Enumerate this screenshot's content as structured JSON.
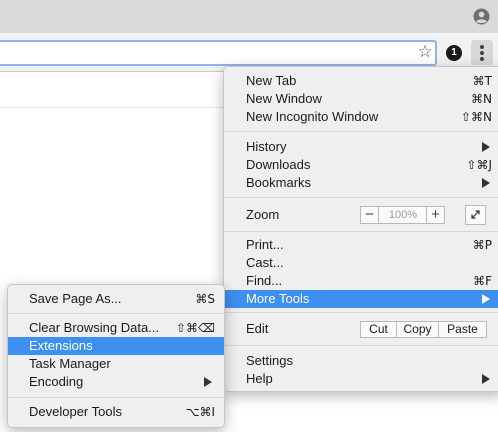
{
  "browser": {
    "profile_icon": "profile-avatar-icon",
    "star_icon": "bookmark-star-icon",
    "extension_badge": "1",
    "menu_icon": "three-dot-menu-icon"
  },
  "main_menu": {
    "new_tab": {
      "label": "New Tab",
      "shortcut": "⌘T"
    },
    "new_window": {
      "label": "New Window",
      "shortcut": "⌘N"
    },
    "new_incognito": {
      "label": "New Incognito Window",
      "shortcut": "⇧⌘N"
    },
    "history": {
      "label": "History"
    },
    "downloads": {
      "label": "Downloads",
      "shortcut": "⇧⌘J"
    },
    "bookmarks": {
      "label": "Bookmarks"
    },
    "zoom": {
      "label": "Zoom",
      "minus": "−",
      "level": "100%",
      "plus": "+"
    },
    "print": {
      "label": "Print...",
      "shortcut": "⌘P"
    },
    "cast": {
      "label": "Cast..."
    },
    "find": {
      "label": "Find...",
      "shortcut": "⌘F"
    },
    "more_tools": {
      "label": "More Tools"
    },
    "edit": {
      "label": "Edit",
      "cut": "Cut",
      "copy": "Copy",
      "paste": "Paste"
    },
    "settings": {
      "label": "Settings"
    },
    "help": {
      "label": "Help"
    }
  },
  "more_tools_menu": {
    "save_page": {
      "label": "Save Page As...",
      "shortcut": "⌘S"
    },
    "clear_data": {
      "label": "Clear Browsing Data...",
      "shortcut": "⇧⌘⌫"
    },
    "extensions": {
      "label": "Extensions"
    },
    "task_manager": {
      "label": "Task Manager"
    },
    "encoding": {
      "label": "Encoding"
    },
    "developer_tools": {
      "label": "Developer Tools",
      "shortcut": "⌥⌘I"
    }
  },
  "colors": {
    "highlight": "#3d8ff0",
    "menu_background": "#efefef",
    "titlebar": "#dadada",
    "omnibox_focus": "#8fb4ee"
  }
}
